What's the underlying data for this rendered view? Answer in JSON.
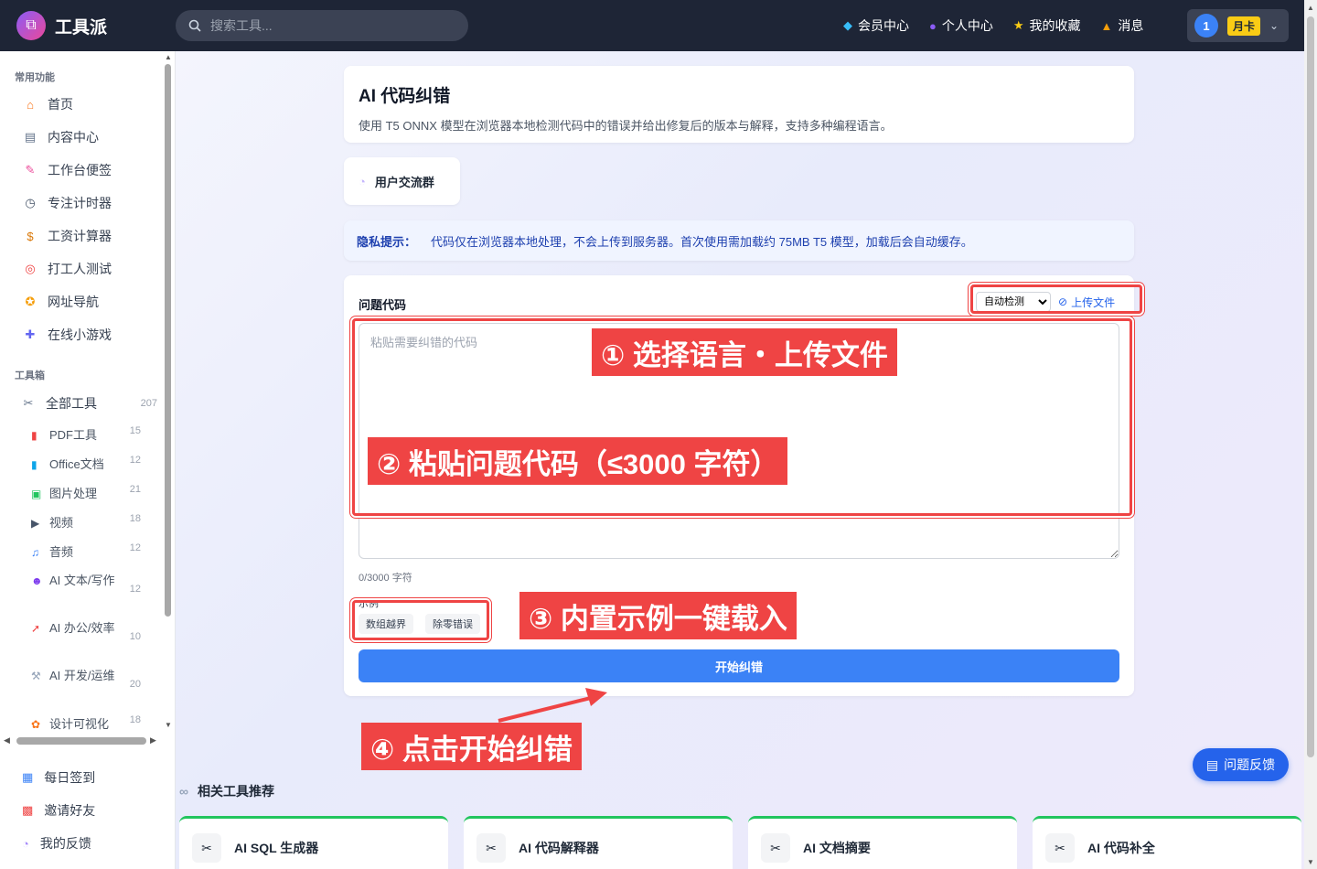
{
  "app": {
    "name": "工具派"
  },
  "search": {
    "placeholder": "搜索工具..."
  },
  "nav": {
    "member": "会员中心",
    "profile": "个人中心",
    "favorites": "我的收藏",
    "messages": "消息"
  },
  "user": {
    "avatar_text": "1",
    "badge": "月卡"
  },
  "sidebar": {
    "common_title": "常用功能",
    "common_items": [
      {
        "label": "首页",
        "icon": "home-icon"
      },
      {
        "label": "内容中心",
        "icon": "newspaper-icon"
      },
      {
        "label": "工作台便签",
        "icon": "memo-icon"
      },
      {
        "label": "专注计时器",
        "icon": "stopwatch-icon"
      },
      {
        "label": "工资计算器",
        "icon": "moneybag-icon"
      },
      {
        "label": "打工人测试",
        "icon": "target-icon"
      },
      {
        "label": "网址导航",
        "icon": "compass-icon"
      },
      {
        "label": "在线小游戏",
        "icon": "gamepad-icon"
      }
    ],
    "toolbox_title": "工具箱",
    "all_tools": {
      "label": "全部工具",
      "count": "207"
    },
    "sub_items": [
      {
        "label": "PDF工具",
        "count": "15"
      },
      {
        "label": "Office文档",
        "count": "12"
      },
      {
        "label": "图片处理",
        "count": "21"
      },
      {
        "label": "视频",
        "count": "18"
      },
      {
        "label": "音频",
        "count": "12"
      },
      {
        "label": "AI 文本/写作",
        "count": "12"
      },
      {
        "label": "AI 办公/效率",
        "count": "10"
      },
      {
        "label": "AI 开发/运维",
        "count": "20"
      },
      {
        "label": "设计可视化",
        "count": "18"
      }
    ],
    "bottom_items": [
      {
        "label": "每日签到"
      },
      {
        "label": "邀请好友"
      },
      {
        "label": "我的反馈"
      }
    ]
  },
  "main": {
    "title": "AI 代码纠错",
    "description": "使用 T5 ONNX 模型在浏览器本地检测代码中的错误并给出修复后的版本与解释，支持多种编程语言。",
    "group_button": "用户交流群",
    "privacy_label": "隐私提示：",
    "privacy_text": "代码仅在浏览器本地处理，不会上传到服务器。首次使用需加载约 75MB T5 模型，加载后会自动缓存。",
    "form": {
      "label": "问题代码",
      "language_selected": "自动检测",
      "upload_label": "上传文件",
      "placeholder": "粘贴需要纠错的代码",
      "counter": "0/3000 字符",
      "examples_label": "示例",
      "examples": [
        "数组越界",
        "除零错误"
      ],
      "start_button": "开始纠错"
    }
  },
  "annotations": {
    "step1": "① 选择语言・上传文件",
    "step2": "② 粘贴问题代码（≤3000 字符）",
    "step3": "③ 内置示例一键载入",
    "step4": "④ 点击开始纠错"
  },
  "related": {
    "title": "相关工具推荐",
    "items": [
      "AI SQL 生成器",
      "AI 代码解释器",
      "AI 文档摘要",
      "AI 代码补全"
    ]
  },
  "feedback": {
    "label": "问题反馈"
  },
  "colors": {
    "accent": "#3b82f6",
    "annotation": "#ef4444",
    "topbar": "#1e2536"
  }
}
